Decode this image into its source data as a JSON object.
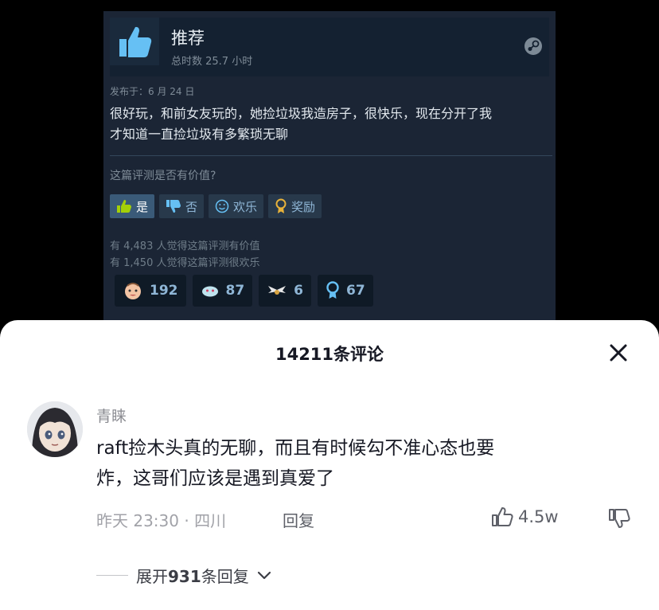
{
  "steam_review": {
    "recommend_label": "推荐",
    "hours_label": "总时数 25.7 小时",
    "posted_label": "发布于：6 月 24 日",
    "review_line1": "很好玩，和前女友玩的，她捡垃圾我造房子，很快乐，现在分开了我",
    "review_line2": "才知道一直捡垃圾有多繁琐无聊",
    "helpful_question": "这篇评测是否有价值?",
    "buttons": {
      "yes": "是",
      "no": "否",
      "funny": "欢乐",
      "award": "奖励"
    },
    "stats": {
      "helpful": "有 4,483 人觉得这篇评测有价值",
      "funny": "有 1,450 人觉得这篇评测很欢乐"
    },
    "award_counts": [
      "192",
      "87",
      "6",
      "67"
    ],
    "colors": {
      "card_bg": "#1b2535",
      "accent": "#66c0f4",
      "active_button": "#3a5a78"
    }
  },
  "comments": {
    "title": "14211条评论",
    "items": [
      {
        "username": "青睐",
        "line1": "raft捡木头真的无聊，而且有时候勾不准心态也要",
        "line2": "炸，这哥们应该是遇到真爱了",
        "meta": "昨天 23:30 · 四川",
        "reply_label": "回复",
        "likes": "4.5w",
        "expand_prefix": "展开",
        "expand_count": "931",
        "expand_suffix": "条回复"
      }
    ]
  }
}
